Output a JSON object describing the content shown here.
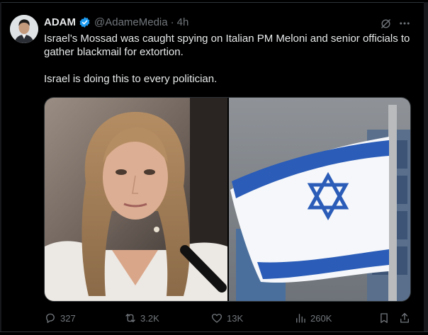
{
  "post": {
    "author": {
      "name": "ADAM",
      "handle": "@AdameMedia",
      "separator": "·",
      "time": "4h",
      "verified": true,
      "verified_color": "#1d9bf0"
    },
    "text": {
      "line1": "Israel’s Mossad was caught spying on Italian PM Meloni and senior officials to gather blackmail for extortion.",
      "line2": "Israel is doing this to every politician."
    },
    "media": {
      "image_count": 2
    },
    "stats": {
      "replies": "327",
      "reposts": "3.2K",
      "likes": "13K",
      "views": "260K"
    }
  },
  "theme": {
    "background": "#000000",
    "text": "#e7e9ea",
    "muted": "#71767b",
    "border": "#2f3336"
  }
}
